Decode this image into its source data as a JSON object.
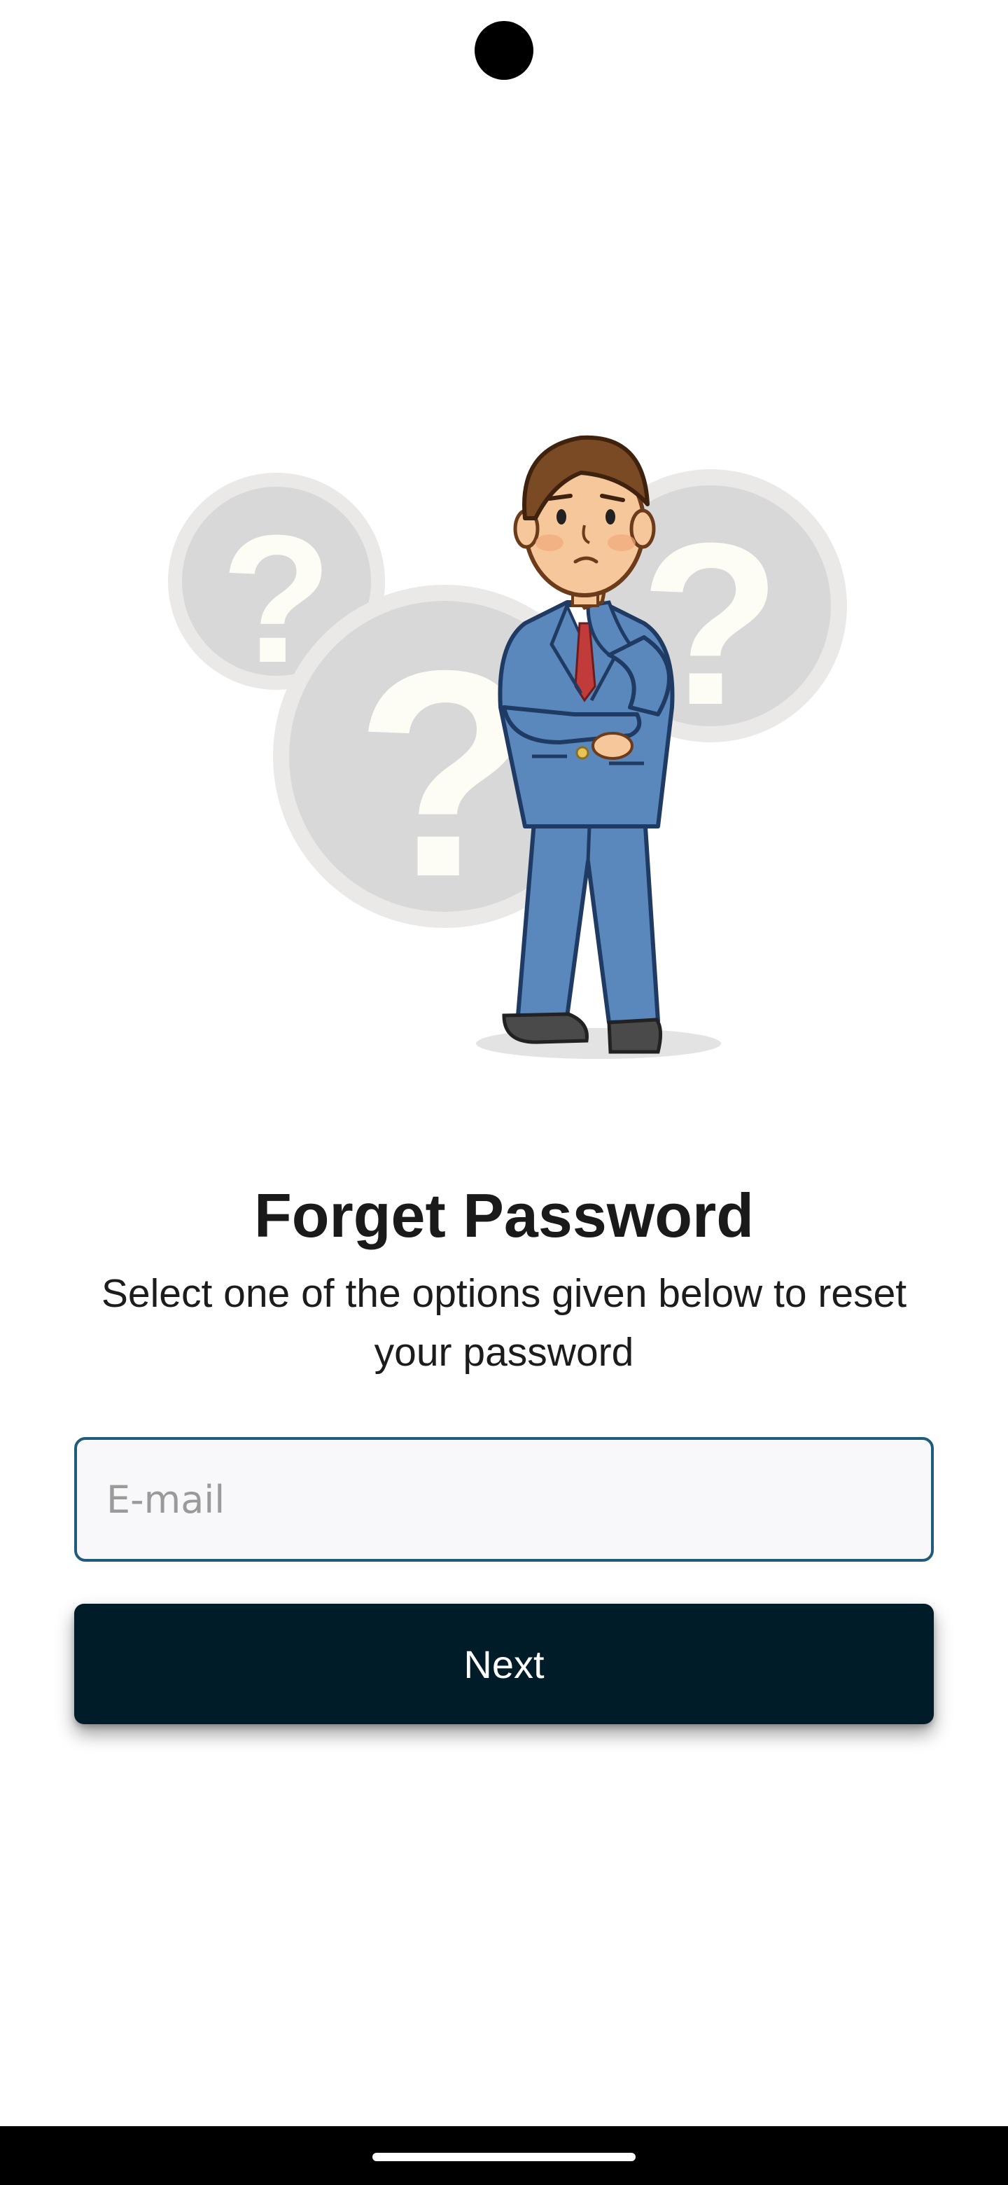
{
  "screen": {
    "title": "Forget Password",
    "subtitle": "Select one of the options given below to reset your password"
  },
  "email_field": {
    "value": "",
    "placeholder": "E-mail"
  },
  "next_button": {
    "label": "Next"
  },
  "illustration": {
    "icon": "confused-businessman-illustration",
    "question_mark": "?"
  },
  "colors": {
    "background": "#ffffff",
    "button": "#001c28",
    "field_border": "#1f5b7a",
    "title": "#1a1a1a"
  }
}
